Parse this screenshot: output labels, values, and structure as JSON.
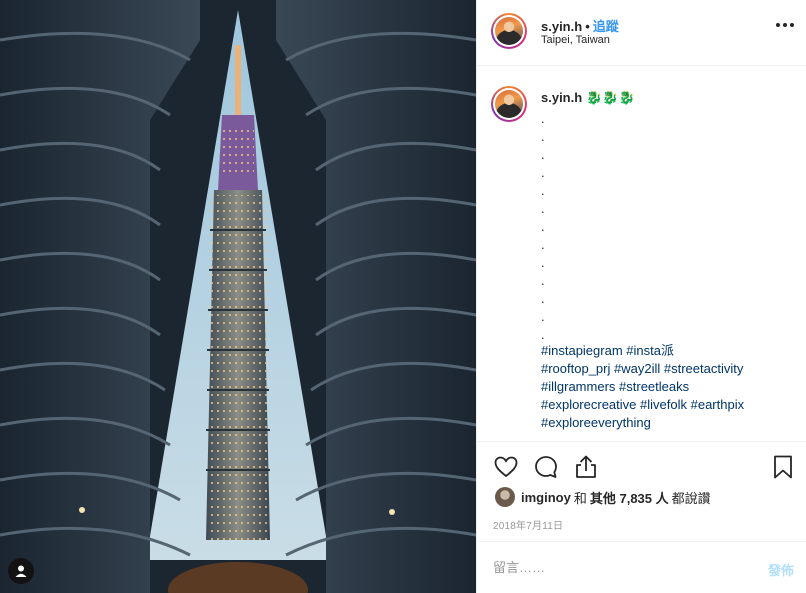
{
  "post": {
    "username": "s.yin.h",
    "follow_label": "追蹤",
    "location": "Taipei, Taiwan"
  },
  "caption": {
    "username": "s.yin.h",
    "emojis": "🐉🐉🐉",
    "dots": ".\n.\n.\n.\n.\n.\n.\n.\n.\n.\n.\n.\n.",
    "hashtags": [
      "#instapiegram",
      "#insta派",
      "#rooftop_prj",
      "#way2ill",
      "#streetactivity",
      "#illgrammers",
      "#streetleaks",
      "#explorecreative",
      "#livefolk",
      "#earthpix",
      "#exploreeverything"
    ]
  },
  "likes": {
    "liker": "imginoy",
    "connector": "和",
    "others": "其他 7,835 人",
    "suffix": "都說讚"
  },
  "date": "2018年7月11日",
  "comment": {
    "placeholder": "留言……",
    "post_label": "發佈"
  },
  "icons": {
    "like": "heart-icon",
    "comment": "comment-icon",
    "share": "share-icon",
    "save": "bookmark-icon",
    "more": "more-options-icon",
    "tag": "user-tag-icon"
  },
  "colors": {
    "follow": "#3897f0",
    "hashtag": "#003569",
    "muted": "#999999",
    "post_disabled": "#b2dffc"
  }
}
